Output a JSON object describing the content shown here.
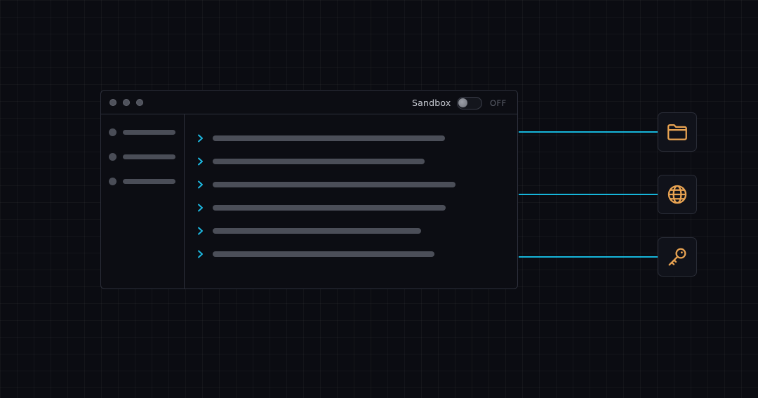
{
  "window": {
    "title_controls": [
      "close",
      "minimize",
      "maximize"
    ],
    "sandbox_label": "Sandbox",
    "sandbox_state": "OFF",
    "sidebar_items": 3,
    "list_rows": 6
  },
  "tools": [
    {
      "icon": "folder-icon"
    },
    {
      "icon": "globe-icon"
    },
    {
      "icon": "key-icon"
    }
  ],
  "colors": {
    "background": "#0b0c12",
    "connector": "#16b5da",
    "chevron": "#1cb8e0",
    "tool_icon": "#e8a352",
    "placeholder": "#4b4e58"
  }
}
